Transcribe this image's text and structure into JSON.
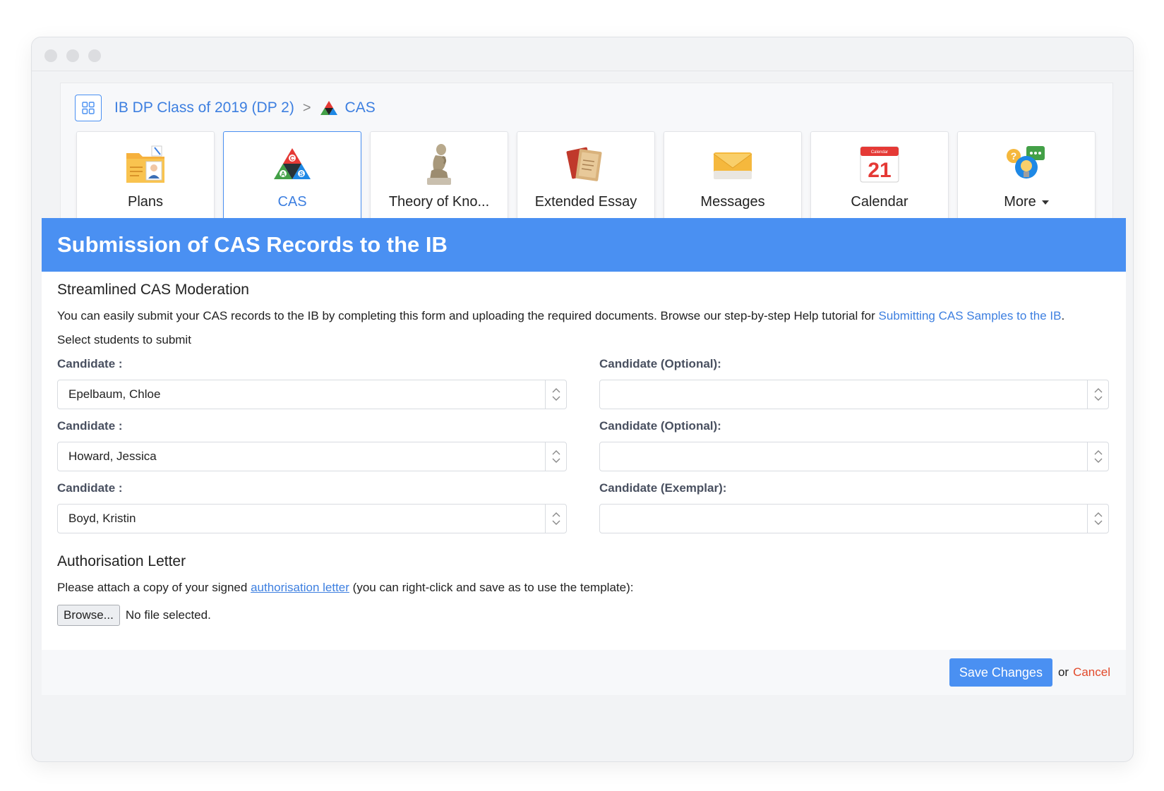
{
  "breadcrumb": {
    "class_link": "IB DP Class of 2019 (DP 2)",
    "separator": ">",
    "current": "CAS"
  },
  "tiles": [
    {
      "label": "Plans",
      "icon": "plans-folder-icon"
    },
    {
      "label": "CAS",
      "icon": "cas-triangle-icon",
      "active": true
    },
    {
      "label": "Theory of Kno...",
      "icon": "thinker-statue-icon"
    },
    {
      "label": "Extended Essay",
      "icon": "notebook-icon"
    },
    {
      "label": "Messages",
      "icon": "envelope-icon"
    },
    {
      "label": "Calendar",
      "icon": "calendar-icon",
      "calendar_day": "21",
      "calendar_header": "Calendar"
    },
    {
      "label": "More",
      "icon": "lightbulb-chat-icon"
    }
  ],
  "banner_title": "Submission of CAS Records to the IB",
  "moderation": {
    "heading": "Streamlined CAS Moderation",
    "text_before": "You can easily submit your CAS records to the IB by completing this form and uploading the required documents. Browse our step-by-step Help tutorial for ",
    "link_text": "Submitting CAS Samples to the IB",
    "text_after": "."
  },
  "select_label": "Select students to submit",
  "fields": [
    {
      "label": "Candidate :",
      "value": "Epelbaum, Chloe"
    },
    {
      "label": "Candidate (Optional):",
      "value": ""
    },
    {
      "label": "Candidate :",
      "value": "Howard, Jessica"
    },
    {
      "label": "Candidate (Optional):",
      "value": ""
    },
    {
      "label": "Candidate :",
      "value": "Boyd, Kristin"
    },
    {
      "label": "Candidate (Exemplar):",
      "value": ""
    }
  ],
  "authorisation": {
    "heading": "Authorisation Letter",
    "text_before": "Please attach a copy of your signed ",
    "link_text": "authorisation letter",
    "text_after": " (you can right-click and save as to use the template):",
    "browse_label": "Browse...",
    "file_status": "No file selected."
  },
  "footer": {
    "save_label": "Save Changes",
    "or_text": "or",
    "cancel_label": "Cancel"
  },
  "colors": {
    "accent": "#4a90f2",
    "link": "#3d7fe0",
    "cancel": "#e2492a"
  }
}
